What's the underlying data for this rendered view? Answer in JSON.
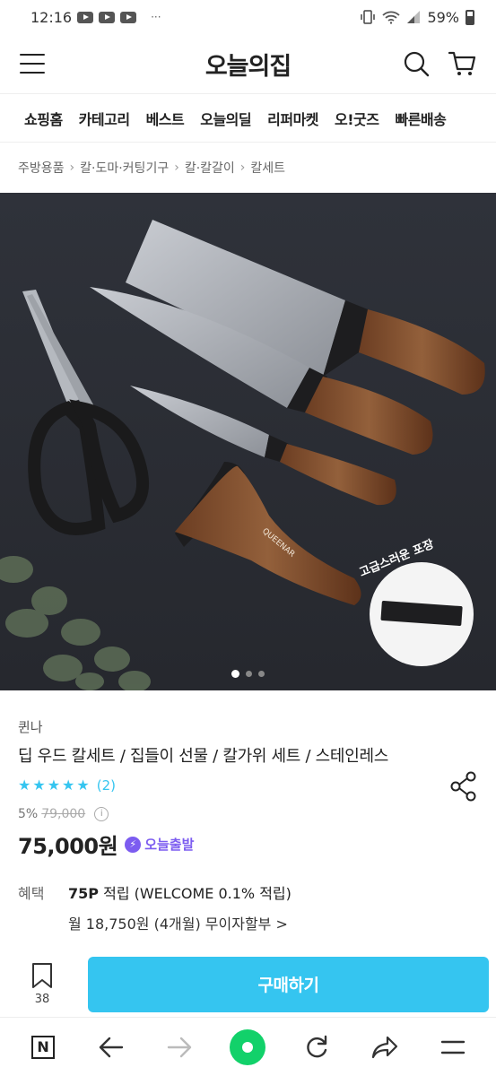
{
  "status_bar": {
    "time": "12:16",
    "dots": "···",
    "battery": "59%"
  },
  "header": {
    "logo": "오늘의집"
  },
  "categories": [
    "쇼핑홈",
    "카테고리",
    "베스트",
    "오늘의딜",
    "리퍼마켓",
    "오!굿즈",
    "빠른배송"
  ],
  "breadcrumb": [
    "주방용품",
    "칼·도마·커팅기구",
    "칼·칼갈이",
    "칼세트"
  ],
  "image": {
    "package_label": "고급스러운 포장",
    "brand_mark": "QUEENAR",
    "page_count": 3,
    "active_page": 0
  },
  "product": {
    "brand": "퀸나",
    "title": "딥 우드 칼세트 / 집들이 선물 / 칼가위 세트 / 스테인레스",
    "rating": 5,
    "review_count": "(2)",
    "discount": "5%",
    "original_price": "79,000",
    "price": "75,000원",
    "delivery_badge": "오늘출발",
    "benefit_label": "혜택",
    "benefit_points": "75P",
    "benefit_text": "적립 (WELCOME 0.1% 적립)",
    "installment": "월 18,750원 (4개월) 무이자할부 >"
  },
  "purchase_bar": {
    "bookmark_count": "38",
    "buy_label": "구매하기"
  },
  "colors": {
    "accent": "#35c5f0",
    "today_purple": "#7c5cf0",
    "naver_green": "#12d16a"
  }
}
